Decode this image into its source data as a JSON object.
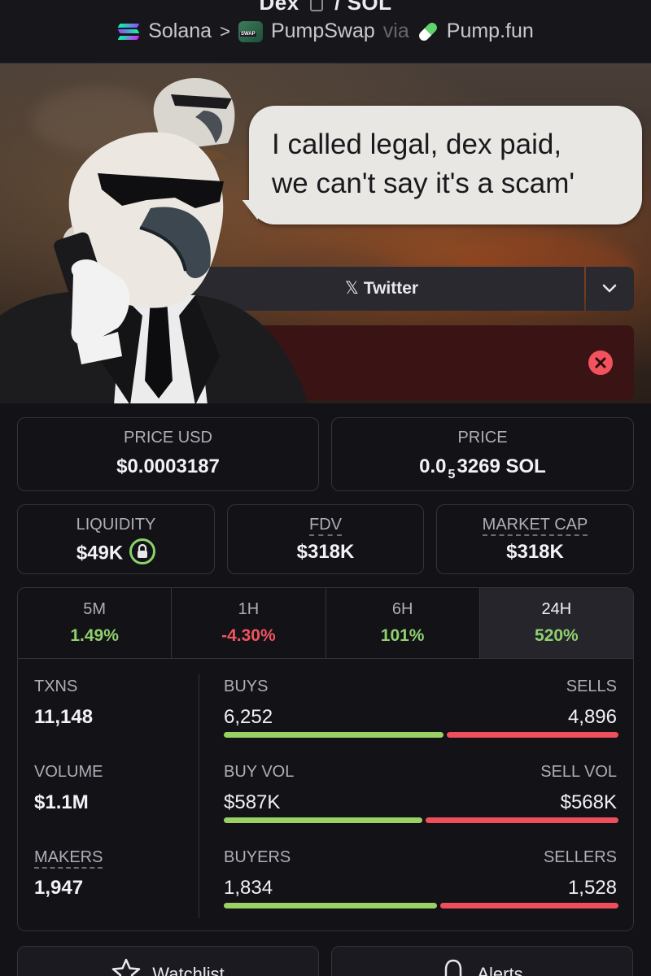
{
  "header": {
    "pair_name": "Dex",
    "pair_sep": "/",
    "pair_quote": "SOL",
    "crumbs": {
      "chain": "Solana",
      "sep": ">",
      "dex": "PumpSwap",
      "via": "via",
      "launchpad": "Pump.fun"
    }
  },
  "banner": {
    "speech": "I called legal, dex paid,\nwe can't say it's a scam'",
    "twitter_icon": "x-logo-icon",
    "twitter_label": "Twitter"
  },
  "stats_top": {
    "price_usd_label": "PRICE USD",
    "price_usd_value": "$0.0003187",
    "price_label": "PRICE",
    "price_prefix": "0.0",
    "price_sub": "5",
    "price_digits": "3269",
    "price_unit": "SOL",
    "liquidity_label": "LIQUIDITY",
    "liquidity_value": "$49K",
    "fdv_label": "FDV",
    "fdv_value": "$318K",
    "mcap_label": "MARKET CAP",
    "mcap_value": "$318K"
  },
  "timeframes": [
    {
      "label": "5M",
      "change": "1.49%",
      "dir": "pos"
    },
    {
      "label": "1H",
      "change": "-4.30%",
      "dir": "neg"
    },
    {
      "label": "6H",
      "change": "101%",
      "dir": "pos"
    },
    {
      "label": "24H",
      "change": "520%",
      "dir": "pos",
      "selected": true
    }
  ],
  "txns": {
    "txns_label": "TXNS",
    "txns_value": "11,148",
    "buys_label": "BUYS",
    "buys_value": "6,252",
    "sells_label": "SELLS",
    "sells_value": "4,896",
    "buys_share": 0.561
  },
  "volume": {
    "volume_label": "VOLUME",
    "volume_value": "$1.1M",
    "buyvol_label": "BUY VOL",
    "buyvol_value": "$587K",
    "sellvol_label": "SELL VOL",
    "sellvol_value": "$568K",
    "buy_share": 0.508
  },
  "makers": {
    "makers_label": "MAKERS",
    "makers_value": "1,947",
    "buyers_label": "BUYERS",
    "buyers_value": "1,834",
    "sellers_label": "SELLERS",
    "sellers_value": "1,528",
    "buyers_share": 0.545
  },
  "actions": {
    "watchlist_label": "Watchlist",
    "alerts_label": "Alerts"
  },
  "colors": {
    "positive": "#8fd06e",
    "negative": "#f0545f",
    "background": "#131217"
  }
}
